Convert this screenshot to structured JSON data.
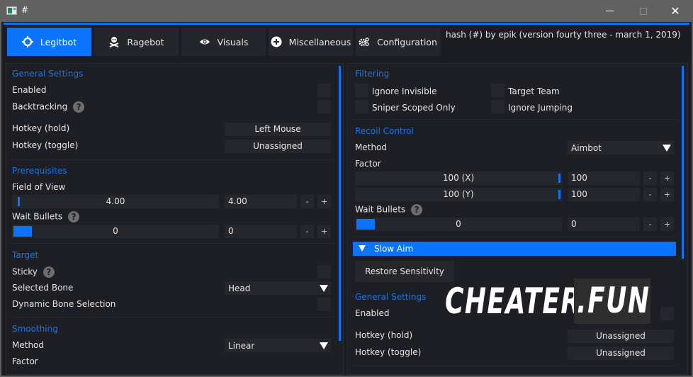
{
  "window": {
    "title": "#",
    "minimize_icon": "minimize-icon",
    "maximize_icon": "maximize-icon",
    "close_icon": "close-icon",
    "close_glyph": "✕"
  },
  "tabs": [
    {
      "label": "Legitbot",
      "icon": "crosshair-icon",
      "active": true
    },
    {
      "label": "Ragebot",
      "icon": "skull-crossbones-icon",
      "active": false
    },
    {
      "label": "Visuals",
      "icon": "eye-icon",
      "active": false
    },
    {
      "label": "Miscellaneous",
      "icon": "plus-circle-icon",
      "active": false
    },
    {
      "label": "Configuration",
      "icon": "gears-icon",
      "active": false
    }
  ],
  "version_text": "hash (#) by epik (version fourty three - march 1, 2019)",
  "colors": {
    "accent": "#0a74ff",
    "section_title": "#1c73e8",
    "background": "#1e1f24",
    "control": "#26272c"
  },
  "left": {
    "general": {
      "title": "General Settings",
      "enabled_label": "Enabled",
      "backtracking_label": "Backtracking",
      "hotkey_hold_label": "Hotkey (hold)",
      "hotkey_hold_value": "Left Mouse",
      "hotkey_toggle_label": "Hotkey (toggle)",
      "hotkey_toggle_value": "Unassigned"
    },
    "prerequisites": {
      "title": "Prerequisites",
      "fov_label": "Field of View",
      "fov_slider_text": "4.00",
      "fov_value": "4.00",
      "wait_bullets_label": "Wait Bullets",
      "wait_bullets_slider_text": "0",
      "wait_bullets_value": "0",
      "minus": "-",
      "plus": "+"
    },
    "target": {
      "title": "Target",
      "sticky_label": "Sticky",
      "selected_bone_label": "Selected Bone",
      "selected_bone_value": "Head",
      "dynamic_bone_label": "Dynamic Bone Selection"
    },
    "smoothing": {
      "title": "Smoothing",
      "method_label": "Method",
      "method_value": "Linear",
      "factor_label": "Factor"
    },
    "help_glyph": "?"
  },
  "right": {
    "filtering": {
      "title": "Filtering",
      "ignore_invisible": "Ignore Invisible",
      "target_team": "Target Team",
      "sniper_scoped_only": "Sniper Scoped Only",
      "ignore_jumping": "Ignore Jumping"
    },
    "recoil": {
      "title": "Recoil Control",
      "method_label": "Method",
      "method_value": "Aimbot",
      "factor_label": "Factor",
      "factor_x_slider_text": "100 (X)",
      "factor_x_value": "100",
      "factor_y_slider_text": "100 (Y)",
      "factor_y_value": "100",
      "wait_bullets_label": "Wait Bullets",
      "wait_bullets_slider_text": "0",
      "wait_bullets_value": "0",
      "minus": "-",
      "plus": "+"
    },
    "slow_aim": {
      "header": "Slow Aim",
      "restore_button": "Restore Sensitivity",
      "general_title": "General Settings",
      "enabled_label": "Enabled",
      "hotkey_hold_label": "Hotkey (hold)",
      "hotkey_hold_value": "Unassigned",
      "hotkey_toggle_label": "Hotkey (toggle)",
      "hotkey_toggle_value": "Unassigned"
    },
    "help_glyph": "?"
  },
  "watermark": {
    "part1": "CHEATER",
    "part2": ".FUN"
  }
}
